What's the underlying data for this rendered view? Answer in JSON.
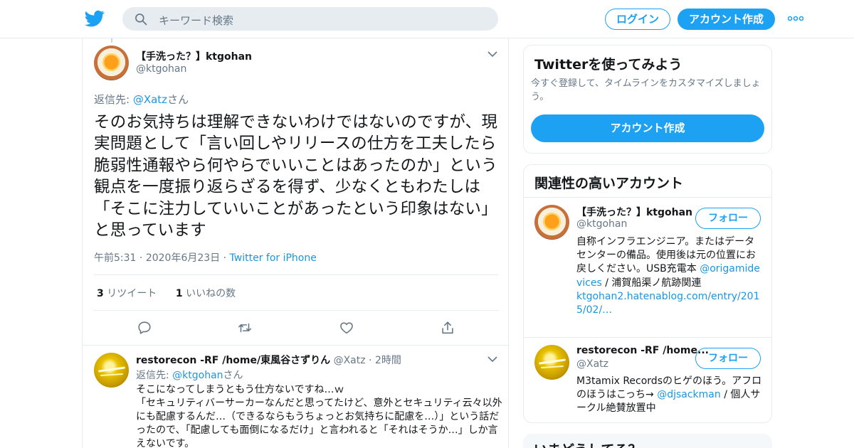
{
  "header": {
    "search_placeholder": "キーワード検索",
    "login_label": "ログイン",
    "signup_label": "アカウント作成"
  },
  "tweet": {
    "display_name": "【手洗った？】ktgohan",
    "handle": "@ktgohan",
    "reply_prefix": "返信先: ",
    "reply_handle": "@Xatz",
    "reply_suffix": "さん",
    "text": "そのお気持ちは理解できないわけではないのですが、現実問題として「言い回しやリリースの仕方を工夫したら脆弱性通報やら何やらでいいことはあったのか」という観点を一度振り返らざるを得ず、少なくともわたしは「そこに注力していいことがあったという印象はない」と思っています",
    "time": "午前5:31",
    "date": "2020年6月23日",
    "source": "Twitter for iPhone",
    "retweet_count": "3",
    "retweet_label": "リツイート",
    "like_count": "1",
    "like_label": "いいねの数"
  },
  "reply": {
    "display_name": "restorecon -RF /home/東風谷さずりん",
    "handle": "@Xatz",
    "time": "2時間",
    "reply_prefix": "返信先: ",
    "reply_handle": "@ktgohan",
    "reply_suffix": "さん",
    "line1": "そこになってしまうともう仕方ないですね…ｗ",
    "line2": "「セキュリティバーサーカーなんだと思ってたけど、意外とセキュリティ云々以外にも配慮するんだ…（できるならもうちょっとお気持ちに配慮を…）」という話だったので、「配慮しても面倒になるだけ」と言われると「それはそうか…」しか言えないです。"
  },
  "signup_card": {
    "title": "Twitterを使ってみよう",
    "description": "今すぐ登録して、タイムラインをカスタマイズしましょう。",
    "button_label": "アカウント作成"
  },
  "related": {
    "title": "関連性の高いアカウント",
    "accounts": [
      {
        "name": "【手洗った？】ktgohan",
        "handle": "@ktgohan",
        "follow_label": "フォロー",
        "bio_text": "自称インフラエンジニア。またはデータセンターの備品。使用後は元の位置にお戻しください。USB充電本 ",
        "bio_link1": "@origamidevices",
        "bio_text2": " / 浦賀船渠ノ航跡関連",
        "bio_link2": "ktgohan2.hatenablog.com/entry/2015/02/…"
      },
      {
        "name": "restorecon -RF /home...",
        "handle": "@Xatz",
        "follow_label": "フォロー",
        "bio_text": "M3tamix Recordsのヒゲのほう。アフロのほうはこっち→ ",
        "bio_link1": "@djsackman",
        "bio_text2": " / 個人サークル絶賛放置中"
      }
    ]
  },
  "whats_happening": {
    "title": "いまどうしてる？"
  }
}
